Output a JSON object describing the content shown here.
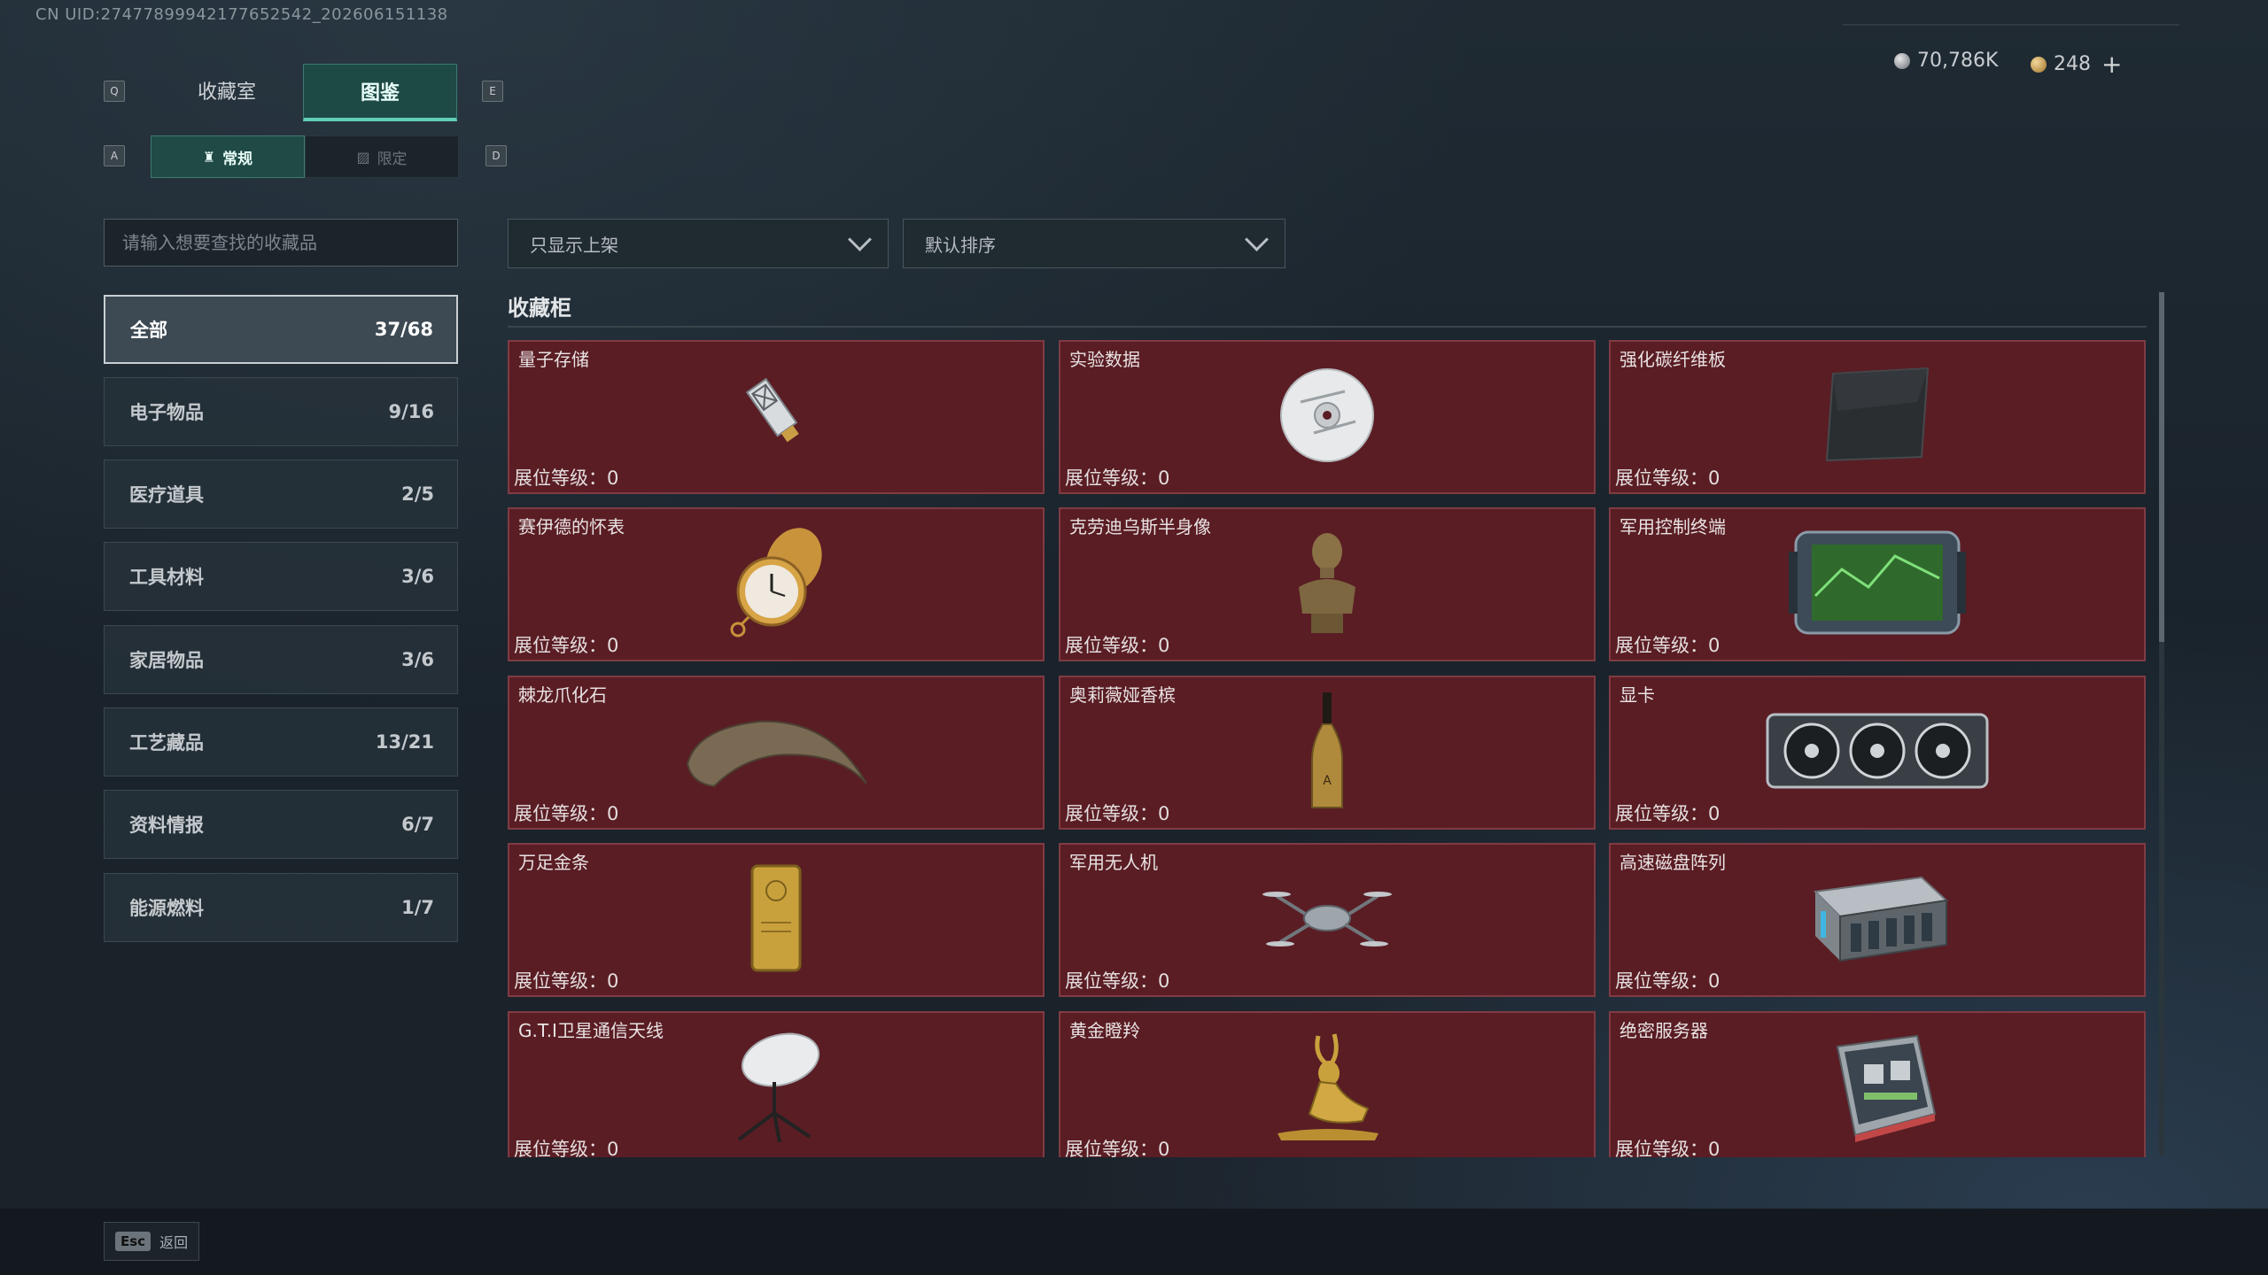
{
  "header": {
    "uid": "CN UID:27477899942177652542_202606151138",
    "currency": [
      {
        "icon": "silver-coin-icon",
        "value": "70,786K"
      },
      {
        "icon": "gold-coin-icon",
        "value": "248"
      }
    ],
    "plus_label": "+"
  },
  "tabs": {
    "prev_key": "Q",
    "next_key": "E",
    "items": [
      {
        "label": "收藏室",
        "active": false
      },
      {
        "label": "图鉴",
        "active": true
      }
    ]
  },
  "subtabs": {
    "prev_key": "A",
    "next_key": "D",
    "items": [
      {
        "label": "常规",
        "icon": "bottle-icon",
        "active": true
      },
      {
        "label": "限定",
        "icon": "image-icon",
        "active": false
      }
    ]
  },
  "search": {
    "placeholder": "请输入想要查找的收藏品"
  },
  "categories": [
    {
      "label": "全部",
      "count": "37/68",
      "active": true
    },
    {
      "label": "电子物品",
      "count": "9/16"
    },
    {
      "label": "医疗道具",
      "count": "2/5"
    },
    {
      "label": "工具材料",
      "count": "3/6"
    },
    {
      "label": "家居物品",
      "count": "3/6"
    },
    {
      "label": "工艺藏品",
      "count": "13/21"
    },
    {
      "label": "资料情报",
      "count": "6/7"
    },
    {
      "label": "能源燃料",
      "count": "1/7"
    }
  ],
  "filters": {
    "display": "只显示上架",
    "sort": "默认排序"
  },
  "section_title": "收藏柜",
  "level_label": "展位等级：0",
  "items": [
    {
      "name": "量子存储",
      "icon": "usb-drive-icon"
    },
    {
      "name": "实验数据",
      "icon": "disc-icon"
    },
    {
      "name": "强化碳纤维板",
      "icon": "carbon-plate-icon"
    },
    {
      "name": "赛伊德的怀表",
      "icon": "pocket-watch-icon"
    },
    {
      "name": "克劳迪乌斯半身像",
      "icon": "bust-icon"
    },
    {
      "name": "军用控制终端",
      "icon": "tablet-terminal-icon"
    },
    {
      "name": "棘龙爪化石",
      "icon": "claw-fossil-icon"
    },
    {
      "name": "奥莉薇娅香槟",
      "icon": "champagne-icon"
    },
    {
      "name": "显卡",
      "icon": "gpu-icon"
    },
    {
      "name": "万足金条",
      "icon": "gold-bar-icon"
    },
    {
      "name": "军用无人机",
      "icon": "drone-icon"
    },
    {
      "name": "高速磁盘阵列",
      "icon": "disk-array-icon"
    },
    {
      "name": "G.T.I卫星通信天线",
      "icon": "satellite-dish-icon"
    },
    {
      "name": "黄金瞪羚",
      "icon": "gazelle-statue-icon"
    },
    {
      "name": "绝密服务器",
      "icon": "server-icon"
    }
  ],
  "footer": {
    "esc_key": "Esc",
    "back_label": "返回"
  },
  "colors": {
    "accent": "#5fd0b6",
    "card_bg": "#5a1d24",
    "card_border": "#7f3b43"
  }
}
